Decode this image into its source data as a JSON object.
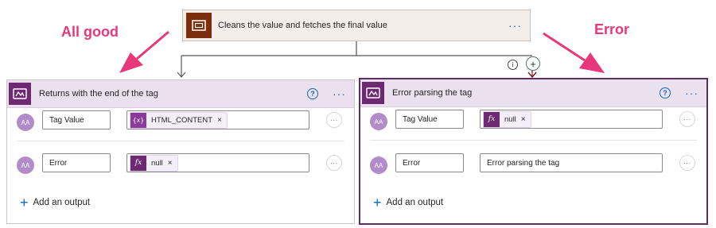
{
  "annotations": {
    "left": "All good",
    "right": "Error"
  },
  "top_action": {
    "title": "Cleans the value and fetches the final value",
    "icon": "scope-icon",
    "more": "···"
  },
  "left_panel": {
    "title": "Returns with the end of the tag",
    "help": "?",
    "more": "···",
    "rows": [
      {
        "name": "Tag Value",
        "token_icon": "{x}",
        "token_label": "HTML_CONTENT",
        "remove": "×",
        "more": "···"
      },
      {
        "name": "Error",
        "token_icon": "fx",
        "token_label": "null",
        "remove": "×",
        "more": "···"
      }
    ],
    "add_output": "Add an output"
  },
  "right_panel": {
    "title": "Error parsing the tag",
    "help": "?",
    "more": "···",
    "rows": [
      {
        "name": "Tag Value",
        "token_icon": "fx",
        "token_label": "null",
        "remove": "×",
        "more": "···"
      },
      {
        "name": "Error",
        "value": "Error parsing the tag",
        "more": "···"
      }
    ],
    "add_output": "Add an output"
  },
  "connector": {
    "info": "i",
    "plus": "+"
  },
  "avatar_text": "AA",
  "colors": {
    "annotation": "#e8377a",
    "scope_tile": "#7a2e0e",
    "response_tile": "#6d2a72",
    "selected_border": "#5c2d63",
    "accent": "#0f6cbd"
  }
}
